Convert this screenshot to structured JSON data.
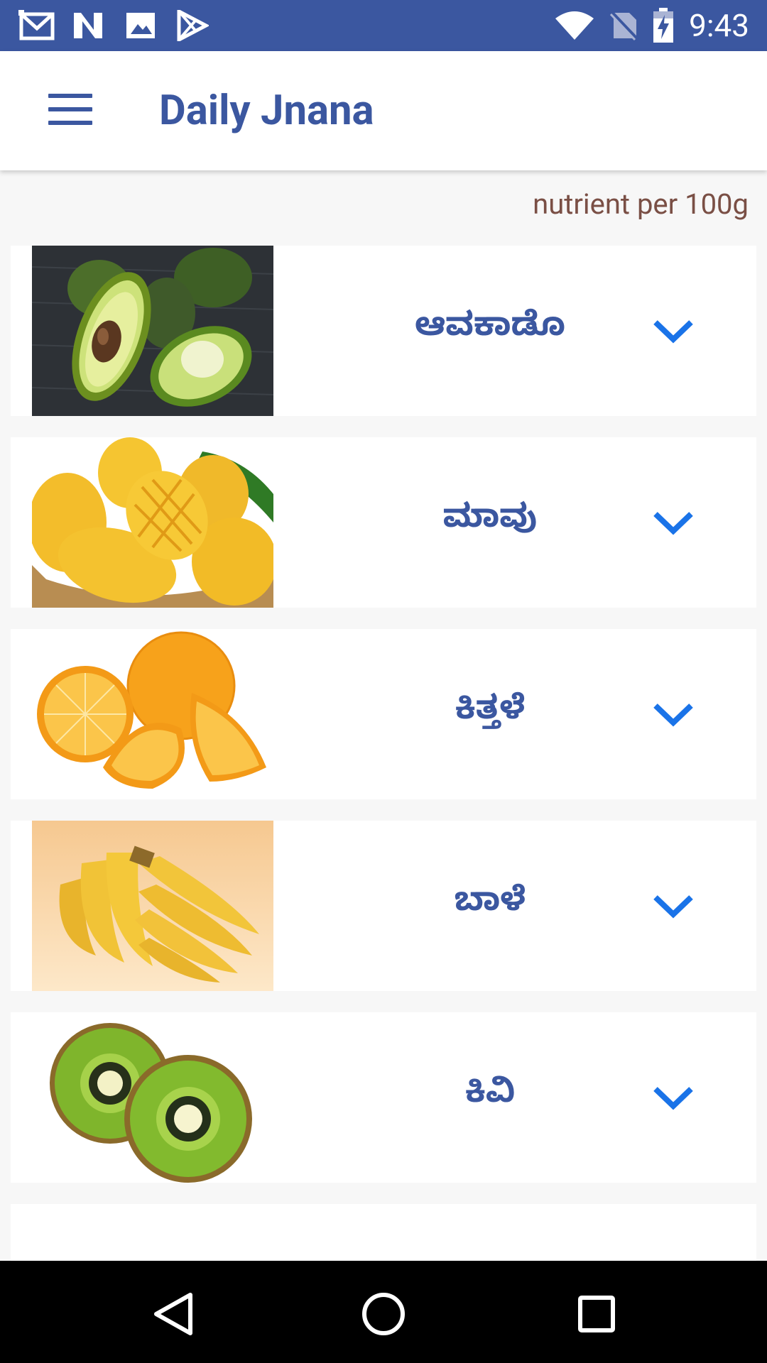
{
  "status_bar": {
    "time": "9:43",
    "icons": [
      "gmail-icon",
      "n-icon",
      "image-icon",
      "play-store-icon",
      "wifi-icon",
      "no-sim-icon",
      "battery-charging-icon"
    ]
  },
  "app_bar": {
    "title": "Daily Jnana",
    "menu_icon": "menu-icon"
  },
  "nutrient_label": "nutrient per 100g",
  "items": [
    {
      "name": "ಆವಕಾಡೊ",
      "image": "avocado"
    },
    {
      "name": "ಮಾವು",
      "image": "mango"
    },
    {
      "name": "ಕಿತ್ತಳೆ",
      "image": "orange"
    },
    {
      "name": "ಬಾಳೆ",
      "image": "banana"
    },
    {
      "name": "ಕಿವಿ",
      "image": "kiwi"
    }
  ],
  "colors": {
    "primary": "#3b57a0",
    "accent_chevron": "#1a73e8",
    "label": "#7a4f45"
  }
}
